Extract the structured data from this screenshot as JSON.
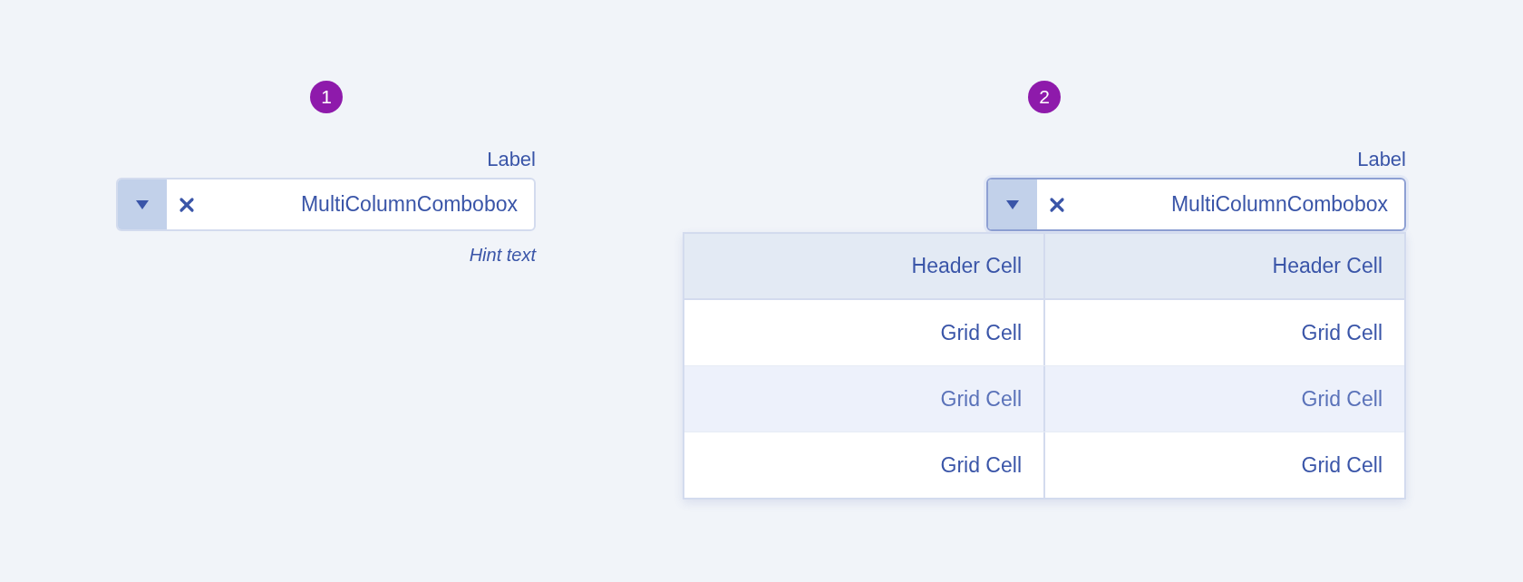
{
  "examples": [
    {
      "badge": "1",
      "label": "Label",
      "value": "MultiColumnCombobox",
      "hint": "Hint text",
      "expanded": false
    },
    {
      "badge": "2",
      "label": "Label",
      "value": "MultiColumnCombobox",
      "expanded": true,
      "table": {
        "columns": [
          "Header Cell",
          "Header Cell"
        ],
        "rows": [
          {
            "cells": [
              "Grid Cell",
              "Grid Cell"
            ],
            "selected": false
          },
          {
            "cells": [
              "Grid Cell",
              "Grid Cell"
            ],
            "selected": true
          },
          {
            "cells": [
              "Grid Cell",
              "Grid Cell"
            ],
            "selected": false
          }
        ]
      }
    }
  ]
}
